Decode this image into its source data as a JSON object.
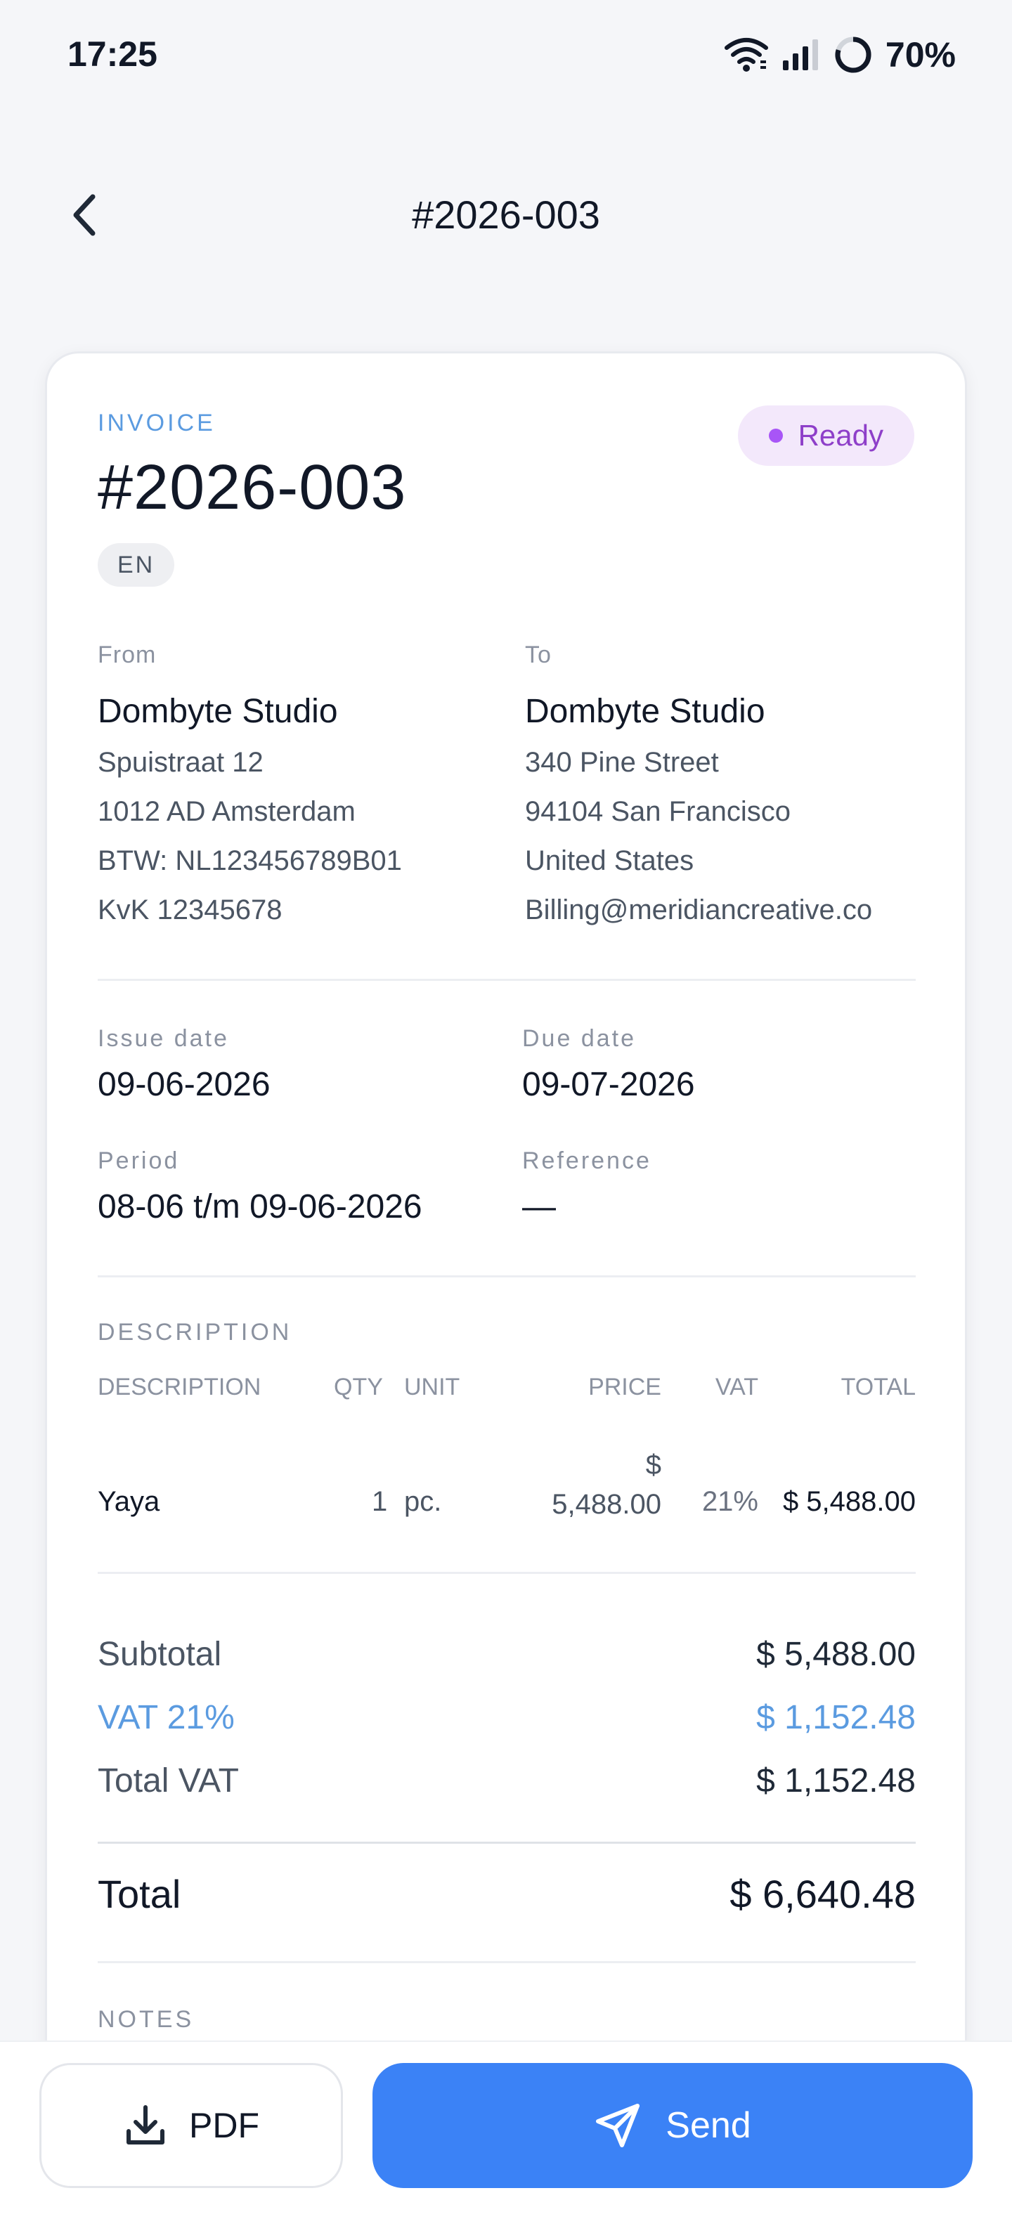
{
  "status_bar": {
    "time": "17:25",
    "battery": "70%"
  },
  "app_bar": {
    "title": "#2026-003"
  },
  "invoice": {
    "kicker": "INVOICE",
    "number": "#2026-003",
    "language": "EN",
    "status": "Ready",
    "from": {
      "label": "From",
      "name": "Dombyte Studio",
      "lines": [
        "Spuistraat 12",
        "1012 AD  Amsterdam",
        "BTW: NL123456789B01",
        "KvK 12345678"
      ]
    },
    "to": {
      "label": "To",
      "name": "Dombyte Studio",
      "lines": [
        "340 Pine Street",
        "94104  San Francisco",
        "United States",
        "Billing@meridiancreative.co"
      ]
    },
    "issue_date": {
      "label": "Issue date",
      "value": "09-06-2026"
    },
    "due_date": {
      "label": "Due date",
      "value": "09-07-2026"
    },
    "period": {
      "label": "Period",
      "value": "08-06 t/m 09-06-2026"
    },
    "reference": {
      "label": "Reference",
      "value": "—"
    },
    "description_section": "DESCRIPTION",
    "columns": {
      "description": "DESCRIPTION",
      "qty": "QTY",
      "unit": "UNIT",
      "price": "PRICE",
      "vat": "VAT",
      "total": "TOTAL"
    },
    "items": [
      {
        "description": "Yaya",
        "qty": "1",
        "unit": "pc.",
        "price_currency": "$",
        "price_amount": "5,488.00",
        "vat": "21%",
        "total": "$ 5,488.00"
      }
    ],
    "summary": {
      "subtotal_label": "Subtotal",
      "subtotal_value": "$ 5,488.00",
      "vat_label": "VAT 21%",
      "vat_value": "$ 1,152.48",
      "total_vat_label": "Total VAT",
      "total_vat_value": "$ 1,152.48",
      "total_label": "Total",
      "total_value": "$ 6,640.48"
    },
    "notes_title": "NOTES"
  },
  "actions": {
    "pdf": "PDF",
    "send": "Send"
  },
  "colors": {
    "accent": "#3b82f6",
    "kicker": "#5b9be0",
    "status_badge_bg": "#f3e8fb",
    "status_badge_text": "#8e3fc9"
  }
}
